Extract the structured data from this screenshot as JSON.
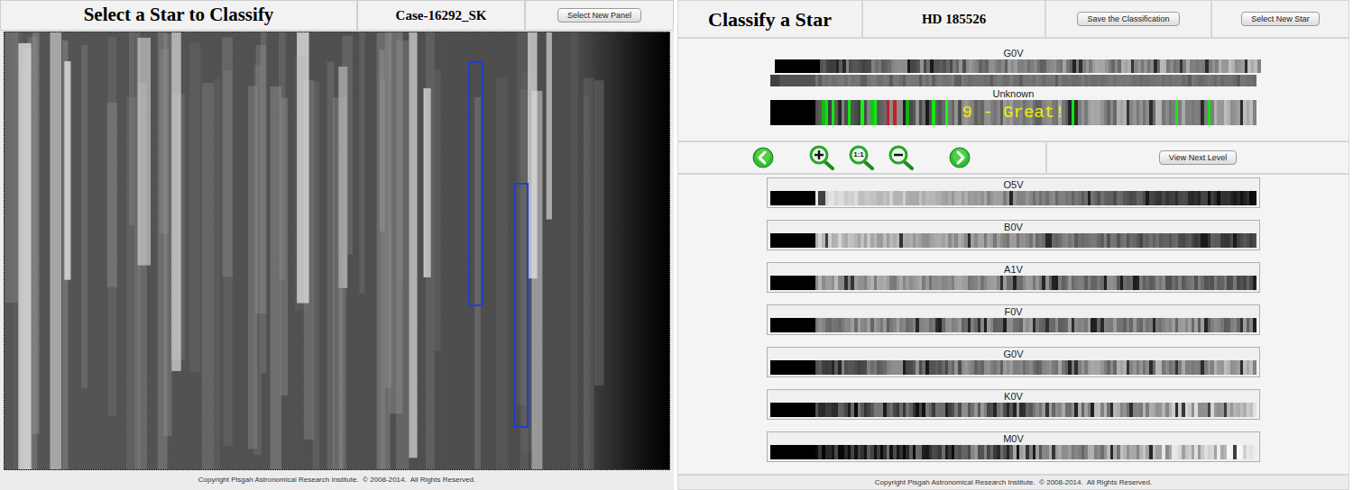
{
  "left_panel": {
    "title": "Select a Star to Classify",
    "case": "Case-16292_SK",
    "button": "Select New Panel",
    "footer": "Copyright Pisgah Astronomical Research Institute.  © 2008-2014.  All Rights Reserved."
  },
  "right_panel": {
    "title": "Classify a Star",
    "star": "HD 185526",
    "buttons": [
      "Save the Classification",
      "Select New Star"
    ],
    "comparison": {
      "standard_label": "G0V",
      "unknown_label": "Unknown",
      "match": "9 - Great!"
    },
    "toolbar": {
      "zoom_reset": "1:1",
      "next_button": "View Next Level"
    },
    "standards": [
      {
        "label": "O5V"
      },
      {
        "label": "B0V"
      },
      {
        "label": "A1V"
      },
      {
        "label": "F0V"
      },
      {
        "label": "G0V"
      },
      {
        "label": "K0V"
      },
      {
        "label": "M0V"
      }
    ],
    "footer": "Copyright Pisgah Astronomical Research Institute.  © 2008-2014.  All Rights Reserved."
  }
}
